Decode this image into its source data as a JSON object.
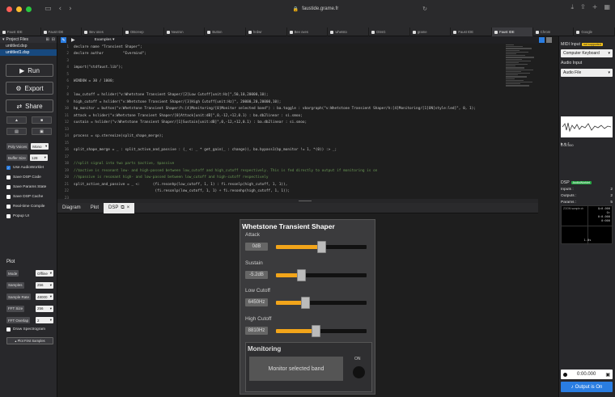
{
  "browser": {
    "url": "faustide.grame.fr",
    "tabs": [
      "Faust IDE",
      "Faust IDE",
      "Bev ones",
      "OBcreep",
      "Neutron",
      "Button",
      "hrdwr",
      "Bev oves",
      "whetsto",
      "OSsG",
      "grame",
      "Faust IDE",
      "Faust IDE",
      "Chrom",
      "Google"
    ],
    "active_tab_index": 12
  },
  "left": {
    "project_files_label": "Project Files",
    "files": [
      "untitled.dsp",
      "untitled1.dsp"
    ],
    "selected_file_index": 1,
    "run_label": "Run",
    "export_label": "Export",
    "share_label": "Share",
    "poly_voices_label": "Poly Voices",
    "poly_voices_value": "Mono",
    "buffer_size_label": "Buffer Size",
    "buffer_size_value": "128",
    "checks": [
      {
        "label": "Use AudioWorklet",
        "on": true
      },
      {
        "label": "Save DSP Code",
        "on": false
      },
      {
        "label": "Save Params State",
        "on": false
      },
      {
        "label": "Save DSP Cache",
        "on": false
      },
      {
        "label": "Real-time Compile",
        "on": false
      },
      {
        "label": "Popup UI",
        "on": false
      }
    ],
    "plot_title": "Plot",
    "plot_rows": [
      {
        "label": "Mode",
        "value": "Offline"
      },
      {
        "label": "Samples",
        "value": "256"
      },
      {
        "label": "Sample Rate",
        "value": "48000"
      },
      {
        "label": "FFT Size",
        "value": "256"
      },
      {
        "label": "FFT Overlap",
        "value": "2"
      }
    ],
    "draw_spectrogram_label": "Draw Spectrogram",
    "plot_first_samples_label": "Plot First Samples"
  },
  "editor": {
    "examples_label": "Examples",
    "lines": [
      {
        "n": "1",
        "t": "declare name \"Transient Shaper\";"
      },
      {
        "n": "2",
        "t": "declare author         \"Evermind\";"
      },
      {
        "n": "3",
        "t": ""
      },
      {
        "n": "4",
        "t": "import(\"stdfaust.lib\");"
      },
      {
        "n": "5",
        "t": ""
      },
      {
        "n": "6",
        "t": "WINDOW = 30 / 1000;"
      },
      {
        "n": "7",
        "t": ""
      },
      {
        "n": "8",
        "t": "low_cutoff = hslider(\"v:Whetstone Transient Shaper/[2]Low Cutoff[unit:Hz]\",50,10,20000,10);"
      },
      {
        "n": "9",
        "t": "high_cutoff = hslider(\"v:Whetstone Transient Shaper/[3]High Cutoff[unit:Hz]\", 20000,20,20000,10);"
      },
      {
        "n": "10",
        "t": "bp_monitor = button(\"v:Whetstone Transient Shaper/h:[4]Monitoring/[0]Monitor selected band\") : ba.toggle : vbargraph(\"v:Whetstone Transient Shaper/h:[4]Monitoring/[1]ON[style:led]\", 0, 1);"
      },
      {
        "n": "11",
        "t": "attack = hslider(\"v:Whetstone Transient Shaper/[0]Attack[unit:dB]\",0,-12,+12,0.1) : ba.db2linear : si.smoo;"
      },
      {
        "n": "12",
        "t": "sustain = hslider(\"v:Whetstone Transient Shaper/[1]Sustain[unit:dB]\",0,-12,+12,0.1) : ba.db2linear : si.smoo;"
      },
      {
        "n": "13",
        "t": ""
      },
      {
        "n": "14",
        "t": "process = sp.stereoize(split_shape_merge);"
      },
      {
        "n": "15",
        "t": ""
      },
      {
        "n": "16",
        "t": "split_shape_merge = _ : split_active_and_passive : (_ <: _ * get_gain(_ : change)), ba.bypass1(bp_monitor != 1, *(0)) :> _;"
      },
      {
        "n": "17",
        "t": ""
      },
      {
        "n": "18",
        "t": "//split signal into two parts $active, $passive",
        "c": true
      },
      {
        "n": "19",
        "t": "//$active is resonant low- and high-passed between low_cutoff and high_cutoff respectively. This is fed directly to output if monitoring is on",
        "c": true
      },
      {
        "n": "20",
        "t": "//$passive is resonant high- and low-passed between low_cutoff and high-cutoff respectively",
        "c": true
      },
      {
        "n": "21",
        "t": "split_active_and_passive = _ <:      (fi.resonhp(low_cutoff, 1, 1) : fi.resonlp(high_cutoff, 1, 1)),"
      },
      {
        "n": "22",
        "t": "                                      (fi.resonlp(low_cutoff, 1, 1) + fi.resonhp(high_cutoff, 1, 1));"
      },
      {
        "n": "23",
        "t": ""
      },
      {
        "n": "24",
        "t": "//$active is analysed with RMS over W ms divided by a lag filter applied to the RMS to get a rise speed over time to get $change",
        "c": true
      },
      {
        "n": "25",
        "t": "change = ba.slidingRMSba.sec2samp(WINDOW)) <: _ - si.lag_ud(WINDOW, WINDOW);"
      },
      {
        "n": "26",
        "t": ""
      },
      {
        "n": "27",
        "t": "//If $change is positive, $gain is $attack",
        "c": true
      },
      {
        "n": "28",
        "t": "//If $change is negative, $gain is $sustain",
        "c": true
      },
      {
        "n": "29",
        "t": "//Smooth $gain",
        "c": true
      }
    ]
  },
  "bottom_tabs": [
    "Diagram",
    "Plot",
    "DSP"
  ],
  "active_bottom_tab": "DSP",
  "faust_ui": {
    "title": "Whetstone Transient Shaper",
    "controls": [
      {
        "name": "Attack",
        "value": "0dB",
        "level": 0.5
      },
      {
        "name": "Sustain",
        "value": "-5.2dB",
        "level": 0.283
      },
      {
        "name": "Low Cutoff",
        "value": "6450Hz",
        "level": 0.322
      },
      {
        "name": "High Cutoff",
        "value": "8810Hz",
        "level": 0.44
      }
    ],
    "monitoring_title": "Monitoring",
    "monitor_button_label": "Monitor selected band",
    "on_label": "ON",
    "accent": "#f2a51a"
  },
  "right": {
    "midi_input_label": "MIDI Input",
    "midi_badge": "not supported",
    "midi_input_value": "Computer Keyboard",
    "audio_input_label": "Audio Input",
    "audio_input_value": "Audio File",
    "wave_time": "0:00.000",
    "dsp_label": "DSP",
    "dsp_badge": "AudioWorklet",
    "inputs_label": "Inputs :",
    "inputs_value": "2",
    "outputs_label": "Outputs :",
    "outputs_value": "2",
    "params_label": "Params :",
    "params_value": "5",
    "scope_zoom": "ZOOM sample ch",
    "scope_readout": "Q=0.000\nQ=\n0:0.000\n0:000",
    "scope_bottom": "1.0s",
    "rec_time": "0:00.000",
    "output_label": "Output is On"
  }
}
